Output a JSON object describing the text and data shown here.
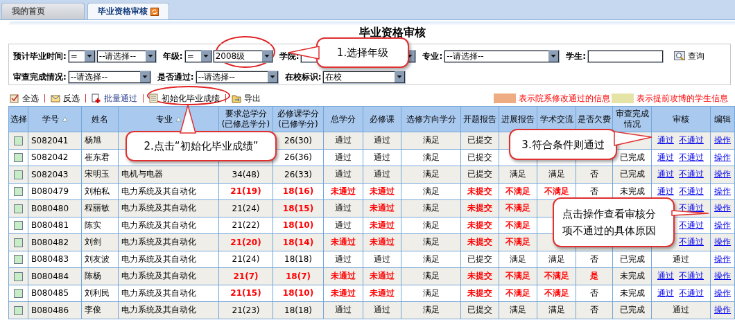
{
  "tabs": [
    {
      "label": "我的首页",
      "selected": false
    },
    {
      "label": "毕业资格审核",
      "selected": true
    }
  ],
  "title": "毕业资格审核",
  "filters": [
    [
      {
        "label": "预计毕业时间:",
        "fields": [
          {
            "kind": "select",
            "value": "="
          },
          {
            "kind": "select",
            "value": "--请选择--"
          }
        ]
      },
      {
        "label": "年级:",
        "fields": [
          {
            "kind": "select",
            "value": "="
          },
          {
            "kind": "select",
            "value": "2008级"
          }
        ]
      },
      {
        "label": "学院:",
        "fields": [
          {
            "kind": "select"
          }
        ]
      },
      {
        "label": "专业:",
        "fields": [
          {
            "kind": "select",
            "value": "--请选择--"
          }
        ]
      },
      {
        "label": "学生:",
        "fields": [
          {
            "kind": "input"
          }
        ]
      }
    ],
    [
      {
        "label": "审查完成情况:",
        "fields": [
          {
            "kind": "select",
            "value": "--请选择--"
          }
        ]
      },
      {
        "label": "是否通过:",
        "fields": [
          {
            "kind": "select",
            "value": "--请选择--"
          }
        ]
      },
      {
        "label": "在校标识:",
        "fields": [
          {
            "kind": "select",
            "value": "在校"
          }
        ]
      }
    ]
  ],
  "search_button": "查询",
  "toolbar": [
    "全选",
    "反选",
    "批量通过",
    "初始化毕业成绩",
    "导出"
  ],
  "legend": [
    {
      "color": "#efab82",
      "text": "表示院系修改通过的信息"
    },
    {
      "color": "#e6e3a6",
      "text": "表示提前攻博的学生信息"
    }
  ],
  "columns": [
    {
      "title": "选择"
    },
    {
      "title": "学号",
      "sortable": true
    },
    {
      "title": "姓名"
    },
    {
      "title": "专业",
      "sortable": true
    },
    {
      "title": "要求总学分\n(已修总学分)"
    },
    {
      "title": "必修课学分\n(已修学分)"
    },
    {
      "title": "总学分"
    },
    {
      "title": "必修课"
    },
    {
      "title": "选修方向学分"
    },
    {
      "title": "开题报告"
    },
    {
      "title": "进展报告"
    },
    {
      "title": "学术交流"
    },
    {
      "title": "是否欠费"
    },
    {
      "title": "审查完成情况"
    },
    {
      "title": "审核"
    },
    {
      "title": "编辑"
    }
  ],
  "rows": [
    {
      "checked": false,
      "cells": [
        {
          "text": "S082041"
        },
        {
          "text": "杨旭"
        },
        null,
        null,
        {
          "text": "26(30)"
        },
        {
          "text": "通过"
        },
        {
          "text": "通过"
        },
        {
          "text": "满足"
        },
        {
          "text": "已提交"
        },
        null,
        null,
        null,
        null
      ],
      "audit": [
        {
          "kind": "pass",
          "text": "通过"
        },
        {
          "kind": "reject",
          "text": "不通过"
        }
      ],
      "edit": "操作"
    },
    {
      "checked": false,
      "cells": [
        {
          "text": "S082042"
        },
        {
          "text": "崔东君"
        },
        null,
        null,
        {
          "text": "26(36)"
        },
        {
          "text": "通过"
        },
        {
          "text": "通过"
        },
        {
          "text": "满足"
        },
        {
          "text": "已提交"
        },
        null,
        null,
        null,
        {
          "text": "已完成"
        }
      ],
      "audit": [
        {
          "kind": "pass",
          "text": "通过"
        },
        {
          "kind": "reject",
          "text": "不通过"
        }
      ],
      "edit": "操作"
    },
    {
      "checked": false,
      "cells": [
        {
          "text": "S082043"
        },
        {
          "text": "宋明玉"
        },
        {
          "text": "电机与电器"
        },
        {
          "text": "34(48)"
        },
        {
          "text": "26(33)"
        },
        {
          "text": "通过"
        },
        {
          "text": "通过"
        },
        {
          "text": "满足"
        },
        {
          "text": "已提交"
        },
        {
          "text": "满足"
        },
        {
          "text": "满足"
        },
        {
          "text": "否"
        },
        {
          "text": "已完成"
        }
      ],
      "audit": [
        {
          "kind": "pass",
          "text": "通过"
        },
        {
          "kind": "reject",
          "text": "不通过"
        }
      ],
      "edit": "操作"
    },
    {
      "checked": false,
      "cells": [
        {
          "text": "B080479"
        },
        {
          "text": "刘柏私"
        },
        {
          "text": "电力系统及其自动化"
        },
        {
          "text": "21(19)",
          "fail": true
        },
        {
          "text": "18(16)",
          "fail": true
        },
        {
          "text": "未通过",
          "fail": true
        },
        {
          "text": "未通过",
          "fail": true
        },
        {
          "text": "满足"
        },
        {
          "text": "未提交",
          "fail": true
        },
        {
          "text": "不满足",
          "fail": true
        },
        {
          "text": "不满足",
          "fail": true
        },
        {
          "text": "否"
        },
        {
          "text": "未完成"
        }
      ],
      "audit": [
        {
          "kind": "pass",
          "text": "通过"
        },
        {
          "kind": "reject",
          "text": "不通过"
        }
      ],
      "edit": "操作"
    },
    {
      "checked": false,
      "cells": [
        {
          "text": "B080480"
        },
        {
          "text": "程丽敏"
        },
        {
          "text": "电力系统及其自动化"
        },
        {
          "text": "21(24)"
        },
        {
          "text": "18(15)",
          "fail": true
        },
        {
          "text": "通过"
        },
        {
          "text": "未通过",
          "fail": true
        },
        {
          "text": "满足"
        },
        {
          "text": "未提交",
          "fail": true
        },
        {
          "text": "不满足",
          "fail": true
        },
        null,
        null,
        null
      ],
      "audit": [
        {
          "kind": "reject",
          "text": "不通过"
        }
      ],
      "edit": "操作"
    },
    {
      "checked": false,
      "cells": [
        {
          "text": "B080481"
        },
        {
          "text": "陈实"
        },
        {
          "text": "电力系统及其自动化"
        },
        {
          "text": "21(22)"
        },
        {
          "text": "18(10)",
          "fail": true
        },
        {
          "text": "通过"
        },
        {
          "text": "未通过",
          "fail": true
        },
        {
          "text": "满足"
        },
        {
          "text": "未提交",
          "fail": true
        },
        {
          "text": "不满足",
          "fail": true
        },
        null,
        null,
        null
      ],
      "audit": [
        {
          "kind": "reject",
          "text": "不通过"
        }
      ],
      "edit": "操作"
    },
    {
      "checked": false,
      "cells": [
        {
          "text": "B080482"
        },
        {
          "text": "刘剑"
        },
        {
          "text": "电力系统及其自动化"
        },
        {
          "text": "21(20)",
          "fail": true
        },
        {
          "text": "18(14)",
          "fail": true
        },
        {
          "text": "未通过",
          "fail": true
        },
        {
          "text": "未通过",
          "fail": true
        },
        {
          "text": "满足"
        },
        {
          "text": "未提交",
          "fail": true
        },
        {
          "text": "不满足",
          "fail": true
        },
        null,
        null,
        null
      ],
      "audit": [
        {
          "kind": "reject",
          "text": "不通过"
        }
      ],
      "edit": "操作"
    },
    {
      "checked": false,
      "cells": [
        {
          "text": "B080483"
        },
        {
          "text": "刘友波"
        },
        {
          "text": "电力系统及其自动化"
        },
        {
          "text": "21(24)"
        },
        {
          "text": "18(18)"
        },
        {
          "text": "通过"
        },
        {
          "text": "通过"
        },
        {
          "text": "满足"
        },
        {
          "text": "已提交"
        },
        {
          "text": "满足"
        },
        {
          "text": "满足"
        },
        {
          "text": "否"
        },
        {
          "text": "已完成"
        }
      ],
      "audit_result": "通过",
      "edit": "操作"
    },
    {
      "checked": false,
      "cells": [
        {
          "text": "B080484"
        },
        {
          "text": "陈杨"
        },
        {
          "text": "电力系统及其自动化"
        },
        {
          "text": "21(7)",
          "fail": true
        },
        {
          "text": "18(7)",
          "fail": true
        },
        {
          "text": "未通过",
          "fail": true
        },
        {
          "text": "未通过",
          "fail": true
        },
        {
          "text": "满足"
        },
        {
          "text": "未提交",
          "fail": true
        },
        {
          "text": "不满足",
          "fail": true
        },
        {
          "text": "不满足",
          "fail": true
        },
        {
          "text": "是",
          "fail": true
        },
        {
          "text": "未完成"
        }
      ],
      "audit": [
        {
          "kind": "pass",
          "text": "通过"
        },
        {
          "kind": "reject",
          "text": "不通过"
        }
      ],
      "edit": "操作"
    },
    {
      "checked": false,
      "cells": [
        {
          "text": "B080485"
        },
        {
          "text": "刘利民"
        },
        {
          "text": "电力系统及其自动化"
        },
        {
          "text": "21(15)",
          "fail": true
        },
        {
          "text": "18(10)",
          "fail": true
        },
        {
          "text": "未通过",
          "fail": true
        },
        {
          "text": "未通过",
          "fail": true
        },
        {
          "text": "满足"
        },
        {
          "text": "未提交",
          "fail": true
        },
        {
          "text": "不满足",
          "fail": true
        },
        {
          "text": "不满足",
          "fail": true
        },
        {
          "text": "否"
        },
        {
          "text": "未完成"
        }
      ],
      "audit": [
        {
          "kind": "pass",
          "text": "通过"
        },
        {
          "kind": "reject",
          "text": "不通过"
        }
      ],
      "edit": "操作"
    },
    {
      "checked": false,
      "cells": [
        {
          "text": "B080486"
        },
        {
          "text": "李俊"
        },
        {
          "text": "电力系统及其自动化"
        },
        {
          "text": "21(23)"
        },
        {
          "text": "18(18)"
        },
        {
          "text": "通过"
        },
        {
          "text": "通过"
        },
        {
          "text": "满足"
        },
        {
          "text": "已提交"
        },
        {
          "text": "满足"
        },
        {
          "text": "满足"
        },
        {
          "text": "否"
        },
        {
          "text": "已完成"
        }
      ],
      "audit_result": "通过",
      "edit": "操作"
    }
  ],
  "callouts": [
    "1.选择年级",
    "2.点击“初始化毕业成绩”",
    "3.符合条件则通过",
    "点击操作查看审核分项不通过的具体原因"
  ]
}
